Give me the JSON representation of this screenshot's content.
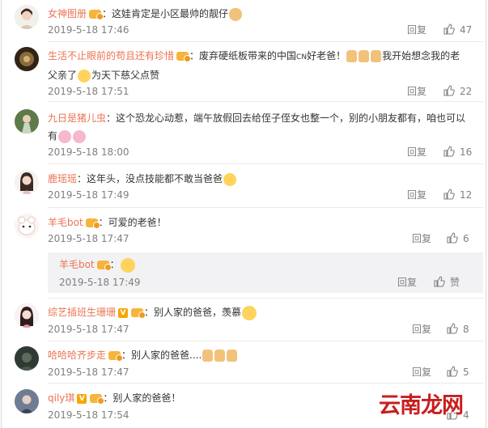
{
  "reply_label": "回复",
  "praise_label": "赞",
  "watermark": "云南龙网",
  "colors": {
    "username": "#eb7350",
    "meta": "#808080",
    "text": "#333333",
    "vip_badge": "#f7b43c",
    "subcomment_bg": "#f2f2f5",
    "watermark": "#c81e1e"
  },
  "comments": [
    {
      "user": "女神图册",
      "text": "：这娃肯定是小区最帅的靓仔",
      "text2": "",
      "time": "2019-5-18 17:46",
      "likes": "47",
      "badge": "vip",
      "emoji": "cat-face"
    },
    {
      "user": "生活不止眼前的苟且还有珍惜",
      "text": "：废弃硬纸板带来的中国",
      "text_mid": "好老爸！",
      "cn_label": "CN",
      "text_after": "我开始想念我的老",
      "text2": "父亲了",
      "text2_after": "为天下慈父点赞",
      "time": "2019-5-18 17:51",
      "likes": "22",
      "badge": "vip",
      "emoji": "thumbs-up"
    },
    {
      "user": "九日是猪儿虫",
      "text": "：这个恐龙心动惹，端午放假回去给侄子侄女也整一个，别的小朋友都有，咱也可以",
      "text2": "有",
      "time": "2019-5-18 18:00",
      "likes": "16",
      "badge": "",
      "emoji": "pig-face"
    },
    {
      "user": "鹿瑶瑶",
      "text": "：这年头，没点技能都不敢当爸爸",
      "text2": "",
      "time": "2019-5-18 17:49",
      "likes": "12",
      "badge": "",
      "emoji": "laughing-face"
    },
    {
      "user": "羊毛bot",
      "text": "：可爱的老爸！",
      "text2": "",
      "time": "2019-5-18 17:47",
      "likes": "6",
      "badge": "vip",
      "emoji": ""
    },
    {
      "user": "综艺插班生珊珊",
      "text": "：别人家的爸爸，羡慕",
      "text2": "",
      "time": "2019-5-18 17:47",
      "likes": "8",
      "badge": "v-vip",
      "v_label": "V",
      "emoji": "shocked-face"
    },
    {
      "user": "哈哈哈齐步走",
      "text": "：别人家的爸爸....",
      "text2": "",
      "time": "2019-5-18 17:47",
      "likes": "5",
      "badge": "vip",
      "emoji": "thumbs-up"
    },
    {
      "user": "qily琪",
      "text": "：别人家的爸爸！",
      "text2": "",
      "time": "2019-5-18 17:54",
      "likes": "4",
      "badge": "v-vip",
      "v_label": "V",
      "emoji": ""
    }
  ],
  "subcomment": {
    "user": "羊毛bot",
    "text": "：",
    "time": "2019-5-18 17:49",
    "emoji": "smile-face"
  }
}
